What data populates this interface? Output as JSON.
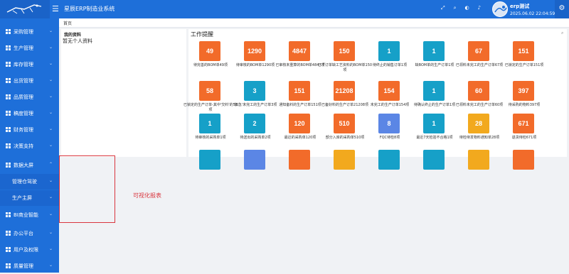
{
  "header": {
    "title": "星辰ERP制造业系统",
    "user_name": "erp测试",
    "user_time": "2025.06.02 22:04:59 星期一",
    "icons": [
      "fullscreen-icon",
      "search-icon",
      "theme-icon",
      "bell-icon",
      "settings-icon"
    ],
    "color": "#1e6fd9"
  },
  "sidebar": {
    "items": [
      {
        "label": "采购管理"
      },
      {
        "label": "生产管理"
      },
      {
        "label": "库存管理"
      },
      {
        "label": "出货管理"
      },
      {
        "label": "品质管理"
      },
      {
        "label": "稿度管理"
      },
      {
        "label": "财务管理"
      },
      {
        "label": "决策支持"
      },
      {
        "label": "数据大屏"
      },
      {
        "label": "管理仓驾驶"
      },
      {
        "label": "生产主屏"
      },
      {
        "label": "BI商业智能"
      },
      {
        "label": "办公平台"
      },
      {
        "label": "用户及权限"
      },
      {
        "label": "质量管理"
      }
    ]
  },
  "tabs": {
    "home": "首页"
  },
  "profile_panel": {
    "title": "我的资料",
    "empty": "暂无个人资料"
  },
  "work_panel": {
    "title": "工作提醒",
    "tiles": [
      {
        "value": "49",
        "caption": "待完善的BOM单49项",
        "color": "#f26b2a"
      },
      {
        "value": "1290",
        "caption": "待审核的BOM单1290项",
        "color": "#f26b2a"
      },
      {
        "value": "4847",
        "caption": "已审核未重算的BOM单4847项",
        "color": "#f26b2a"
      },
      {
        "value": "150",
        "caption": "已下订单缺工艺资料的BOM单150项",
        "color": "#f26b2a"
      },
      {
        "value": "1",
        "caption": "待终止的销售订单1项",
        "color": "#16a0c8"
      },
      {
        "value": "1",
        "caption": "缺BOM单的生产订单1项",
        "color": "#16a0c8"
      },
      {
        "value": "67",
        "caption": "已领料未完工的生产订单67项",
        "color": "#f26b2a"
      },
      {
        "value": "151",
        "caption": "已锁定的生产订单151项",
        "color": "#f26b2a"
      },
      {
        "value": "58",
        "caption": "已锁定的生产订单-其中'交料'的58项",
        "color": "#f26b2a"
      },
      {
        "value": "3",
        "caption": "'加急'未完工的生产订单3项",
        "color": "#16a0c8"
      },
      {
        "value": "151",
        "caption": "通知备料的生产订单151项",
        "color": "#f26b2a"
      },
      {
        "value": "21208",
        "caption": "已备好料的生产订单21208项",
        "color": "#f26b2a"
      },
      {
        "value": "154",
        "caption": "未完工的生产订单154项",
        "color": "#f26b2a"
      },
      {
        "value": "1",
        "caption": "待确认终止的生产订单1项",
        "color": "#16a0c8"
      },
      {
        "value": "60",
        "caption": "已领料未完工的生产订单60项",
        "color": "#f26b2a"
      },
      {
        "value": "397",
        "caption": "待采购的物料397项",
        "color": "#f26b2a"
      },
      {
        "value": "1",
        "caption": "待审核的采购单1项",
        "color": "#16a0c8"
      },
      {
        "value": "2",
        "caption": "待送出的采购单2项",
        "color": "#16a0c8"
      },
      {
        "value": "120",
        "caption": "最近的采购单120项",
        "color": "#f26b2a"
      },
      {
        "value": "510",
        "caption": "部分入库的采购单510项",
        "color": "#f26b2a"
      },
      {
        "value": "8",
        "caption": "FQC待检8项",
        "color": "#5b86e5"
      },
      {
        "value": "1",
        "caption": "最近7天检验不合格1项",
        "color": "#16a0c8"
      },
      {
        "value": "28",
        "caption": "待检待发物料通知单28项",
        "color": "#f2a91e"
      },
      {
        "value": "671",
        "caption": "退货待检671项",
        "color": "#f26b2a"
      },
      {
        "value": "",
        "caption": "",
        "color": "#16a0c8"
      },
      {
        "value": "",
        "caption": "",
        "color": "#5b86e5"
      },
      {
        "value": "",
        "caption": "",
        "color": "#f26b2a"
      },
      {
        "value": "",
        "caption": "",
        "color": "#f2a91e"
      },
      {
        "value": "",
        "caption": "",
        "color": "#16a0c8"
      },
      {
        "value": "",
        "caption": "",
        "color": "#16a0c8"
      },
      {
        "value": "",
        "caption": "",
        "color": "#f2a91e"
      },
      {
        "value": "",
        "caption": "",
        "color": "#f26b2a"
      }
    ]
  },
  "annotation": {
    "text": "可视化报表",
    "color": "#d9363e"
  }
}
